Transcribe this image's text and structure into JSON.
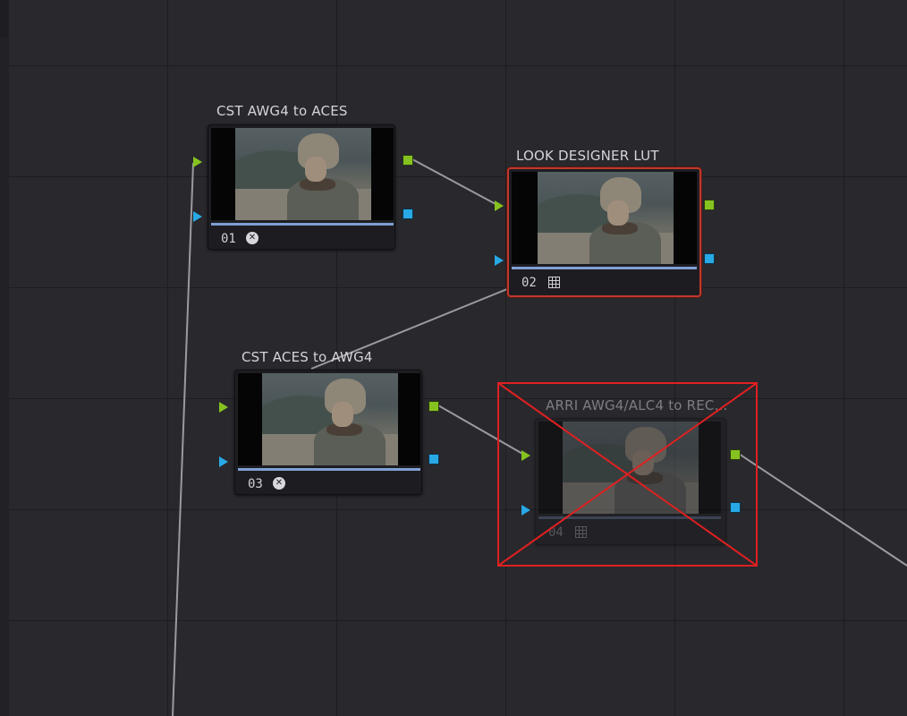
{
  "app": "DaVinci Resolve Color Page Node Editor",
  "colors": {
    "canvas": "#28282d",
    "grid": "#1d1d21",
    "rgb_port": "#86c21f",
    "key_port": "#28a9e6",
    "selection": "#c0392b",
    "disabled_cross": "#e02020",
    "wire": "#9a9a9f"
  },
  "nodes": [
    {
      "id": "n1",
      "title": "CST AWG4 to ACES",
      "number": "01",
      "icon": "aces-icon",
      "selected": false,
      "disabled": false
    },
    {
      "id": "n2",
      "title": "LOOK DESIGNER LUT",
      "number": "02",
      "icon": "lut-grid-icon",
      "selected": true,
      "disabled": false
    },
    {
      "id": "n3",
      "title": "CST ACES to AWG4",
      "number": "03",
      "icon": "aces-icon",
      "selected": false,
      "disabled": false
    },
    {
      "id": "n4",
      "title": "ARRI AWG4/ALC4 to REC...",
      "number": "04",
      "icon": "lut-grid-icon",
      "selected": false,
      "disabled": true
    }
  ]
}
